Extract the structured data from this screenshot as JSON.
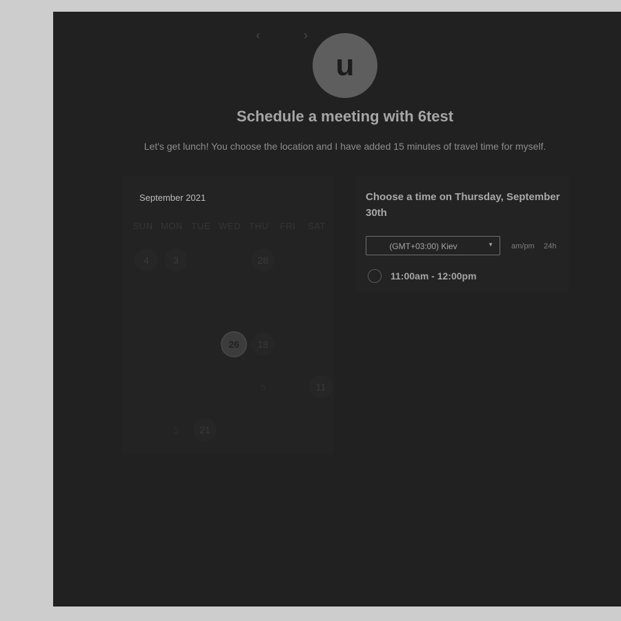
{
  "host": {
    "avatar_initial": "u",
    "title": "Schedule a meeting with 6test",
    "description": "Let's get lunch! You choose the location and I have added 15 minutes of travel time for myself."
  },
  "calendar": {
    "month_label": "September 2021",
    "prev_icon": "‹",
    "next_icon": "›",
    "weekdays": [
      "SUN",
      "MON",
      "TUE",
      "WED",
      "THU",
      "FRI",
      "SAT"
    ],
    "day_cells": [
      "4",
      "3",
      "28",
      "26",
      "18",
      "5",
      "11",
      "5",
      "21"
    ],
    "selected_day": "26"
  },
  "times": {
    "heading": "Choose a time on Thursday, September 30th",
    "timezone": "(GMT+03:00) Kiev",
    "format_ampm": "am/pm",
    "format_24h": "24h",
    "slots": [
      "11:00am - 12:00pm"
    ]
  },
  "colors": {
    "background": "#cdcdcd",
    "panel": "#212121",
    "card": "#232323",
    "avatar": "#5e5e5e"
  }
}
